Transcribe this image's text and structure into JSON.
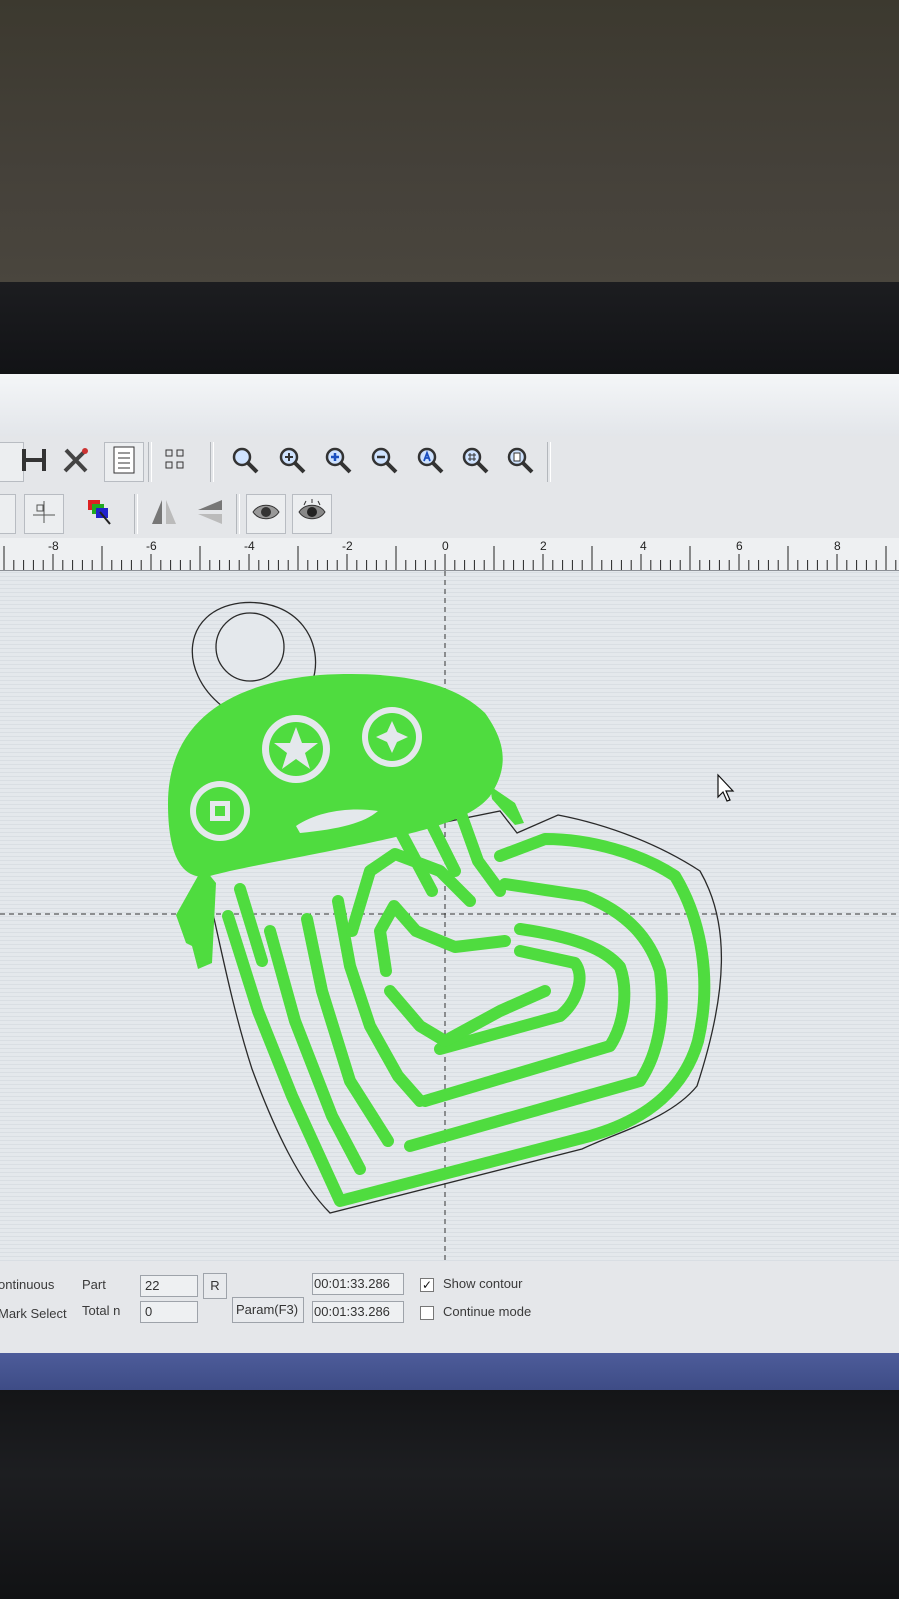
{
  "ruler": {
    "labels": [
      "-8",
      "-6",
      "-4",
      "-2",
      "0",
      "2",
      "4",
      "6",
      "8"
    ]
  },
  "toolbar": {
    "icons": [
      "hatch-icon",
      "tools-icon",
      "list-icon",
      "node-icon",
      "zoom-icon",
      "zoom-in-icon",
      "zoom-plus-icon",
      "zoom-out-icon",
      "zoom-all-icon",
      "zoom-grid-icon",
      "zoom-page-icon"
    ],
    "icons_row2": [
      "align-icon",
      "color-layers-icon",
      "mirror-horizontal-icon",
      "mirror-vertical-icon",
      "eye-icon",
      "eye-alt-icon"
    ]
  },
  "status": {
    "continuous": "ontinuous",
    "mark_select": "Mark Select",
    "part_label": "Part",
    "part_value": "22",
    "total_label": "Total n",
    "total_value": "0",
    "r_button": "R",
    "param_button": "Param(F3)",
    "time1": "00:01:33.286",
    "time2": "00:01:33.286",
    "show_contour": "Show contour",
    "show_contour_checked": true,
    "continue_mode": "Continue mode",
    "continue_mode_checked": false
  },
  "colors": {
    "fill": "#4fdc3f",
    "contour": "#2a2a2a"
  }
}
